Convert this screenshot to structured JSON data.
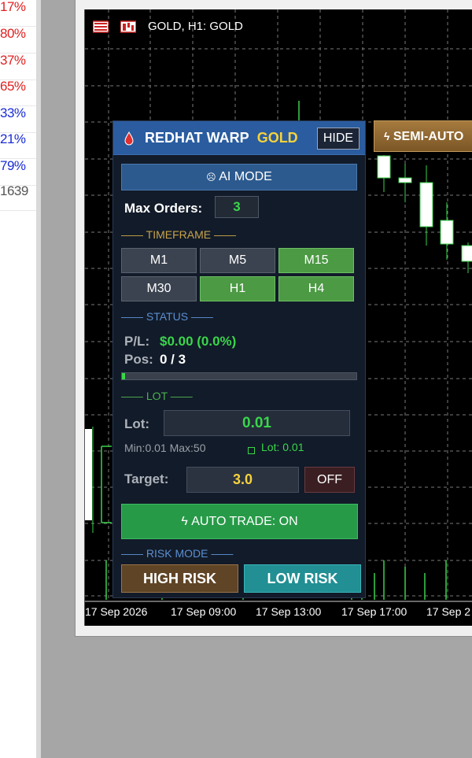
{
  "left_column": [
    {
      "text": "17%",
      "color": "#e02020"
    },
    {
      "text": "80%",
      "color": "#e02020"
    },
    {
      "text": "37%",
      "color": "#e02020"
    },
    {
      "text": "65%",
      "color": "#e02020"
    },
    {
      "text": "33%",
      "color": "#1a2cd4"
    },
    {
      "text": "21%",
      "color": "#1a2cd4"
    },
    {
      "text": "79%",
      "color": "#1a2cd4"
    },
    {
      "text": "1639",
      "color": "#555555"
    }
  ],
  "chart": {
    "title": "GOLD, H1:  GOLD",
    "x_labels": [
      "17 Sep 2026",
      "17 Sep 09:00",
      "17 Sep 13:00",
      "17 Sep 17:00",
      "17 Sep 2"
    ]
  },
  "semi_button": {
    "label": "SEMI-AUTO"
  },
  "panel": {
    "title": "REDHAT WARP",
    "title_accent": "GOLD",
    "hide_label": "HIDE",
    "ai_mode_label": "AI MODE",
    "max_orders_label": "Max Orders:",
    "max_orders_value": "3",
    "timeframe_header": "TIMEFRAME",
    "timeframes": [
      {
        "label": "M1",
        "active": false
      },
      {
        "label": "M5",
        "active": false
      },
      {
        "label": "M15",
        "active": true
      },
      {
        "label": "M30",
        "active": false
      },
      {
        "label": "H1",
        "active": true
      },
      {
        "label": "H4",
        "active": true
      }
    ],
    "status_header": "STATUS",
    "pl_label": "P/L:",
    "pl_value": "$0.00 (0.0%)",
    "pos_label": "Pos:",
    "pos_value": "0 / 3",
    "pos_fraction": 0,
    "lot_header": "LOT",
    "lot_label": "Lot:",
    "lot_value": "0.01",
    "lot_min_max": "Min:0.01 Max:50",
    "lot_current": "Lot: 0.01",
    "target_label": "Target:",
    "target_value": "3.0",
    "target_toggle": "OFF",
    "auto_trade_label": "AUTO TRADE: ON",
    "risk_header": "RISK MODE",
    "high_risk_label": "HIGH RISK",
    "low_risk_label": "LOW RISK"
  },
  "colors": {
    "active_green": "#4c9a44",
    "inactive_gray": "#3c4350",
    "accent_gold": "#f5d23c",
    "pl_green": "#39d64a"
  }
}
